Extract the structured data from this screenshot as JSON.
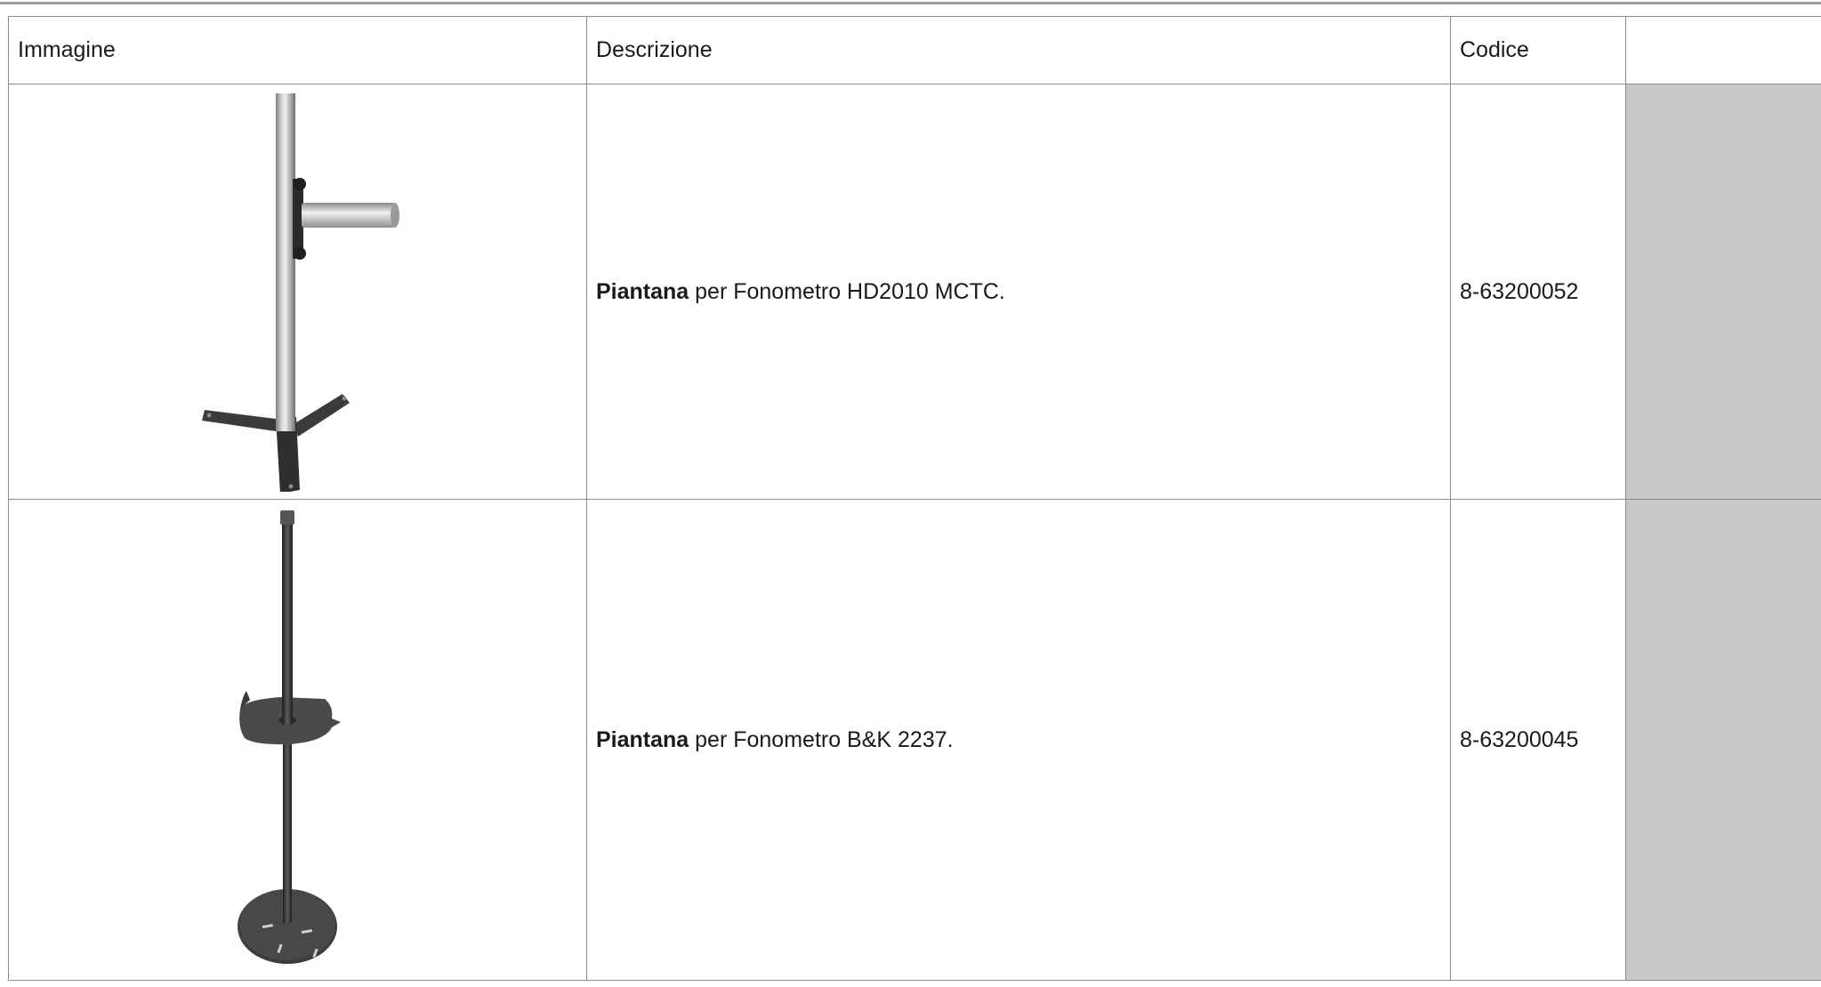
{
  "table": {
    "headers": {
      "image": "Immagine",
      "description": "Descrizione",
      "code": "Codice",
      "extra": ""
    },
    "rows": [
      {
        "image_icon": "aluminium-stand-tripod-base-icon",
        "desc_bold": "Piantana",
        "desc_rest": " per Fonometro HD2010 MCTC.",
        "code": "8-63200052"
      },
      {
        "image_icon": "dark-stand-with-tray-icon",
        "desc_bold": "Piantana",
        "desc_rest": " per Fonometro B&K 2237.",
        "code": "8-63200045"
      }
    ]
  },
  "colors": {
    "border": "#8c8c8c",
    "extra_cell_bg": "#c8c8c8"
  }
}
